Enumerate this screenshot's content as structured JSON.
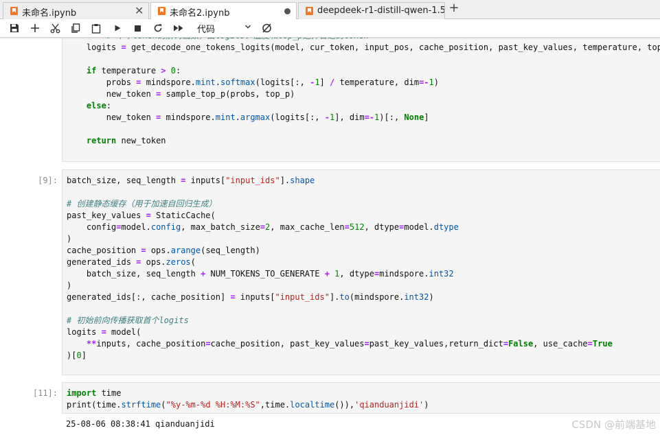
{
  "tabs": [
    {
      "label": "未命名.ipynb",
      "active": false,
      "state": "close"
    },
    {
      "label": "未命名2.ipynb",
      "active": true,
      "state": "unsaved"
    },
    {
      "label": "deepdeek-r1-distill-qwen-1.5",
      "active": false,
      "state": "none"
    }
  ],
  "toolbar": {
    "cell_type": "代码"
  },
  "colors": {
    "accent": "#f37726",
    "keyword": "#008000",
    "operator": "#aa22ff",
    "string": "#ba2121",
    "comment": "#408080"
  },
  "cells": {
    "c1": {
      "prompt": "",
      "lines": [
        "        # 单个token的解码函数，由logits、温度和top_p选择合适的token",
        "    logits = get_decode_one_tokens_logits(model, cur_token, input_pos, cache_position, past_key_values, temperature, top_p)",
        "",
        "    if temperature > 0:",
        "        probs = mindspore.mint.softmax(logits[:, -1] / temperature, dim=-1)",
        "        new_token = sample_top_p(probs, top_p)",
        "    else:",
        "        new_token = mindspore.mint.argmax(logits[:, -1], dim=-1)[:, None]",
        "",
        "    return new_token"
      ]
    },
    "c2": {
      "prompt": "[9]:",
      "lines": [
        "batch_size, seq_length = inputs[\"input_ids\"].shape",
        "",
        "# 创建静态缓存（用于加速自回归生成）",
        "past_key_values = StaticCache(",
        "    config=model.config, max_batch_size=2, max_cache_len=512, dtype=model.dtype",
        ")",
        "cache_position = ops.arange(seq_length)",
        "generated_ids = ops.zeros(",
        "    batch_size, seq_length + NUM_TOKENS_TO_GENERATE + 1, dtype=mindspore.int32",
        ")",
        "generated_ids[:, cache_position] = inputs[\"input_ids\"].to(mindspore.int32)",
        "",
        "# 初始前向传播获取首个logits",
        "logits = model(",
        "    **inputs, cache_position=cache_position, past_key_values=past_key_values,return_dict=False, use_cache=True",
        ")[0]"
      ]
    },
    "c3": {
      "prompt": "[11]:",
      "lines": [
        "import time",
        "print(time.strftime(\"%y-%m-%d %H:%M:%S\",time.localtime()),'qianduanjidi')"
      ],
      "output": "25-08-06 08:38:41 qianduanjidi"
    }
  },
  "watermark": "CSDN @前端基地"
}
